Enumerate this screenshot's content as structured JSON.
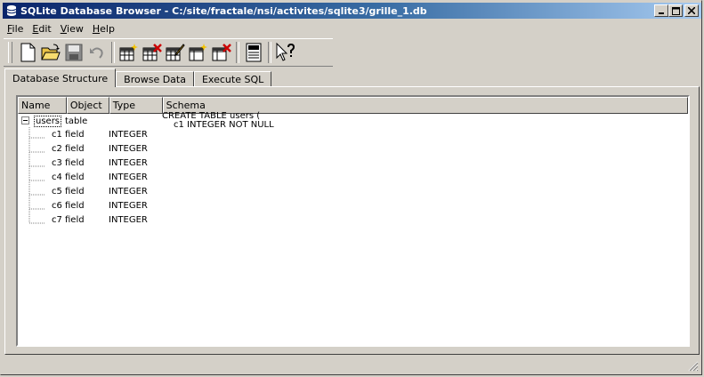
{
  "window": {
    "title": "SQLite Database Browser - C:/site/fractale/nsi/activites/sqlite3/grille_1.db",
    "buttons": {
      "minimize": "_",
      "maximize": "□",
      "close": "×"
    }
  },
  "menu": {
    "items": [
      "File",
      "Edit",
      "View",
      "Help"
    ]
  },
  "toolbar": {
    "buttons": [
      {
        "name": "new-database",
        "icon": "new-file-icon"
      },
      {
        "name": "open-database",
        "icon": "open-folder-icon"
      },
      {
        "name": "save-changes",
        "icon": "save-disk-icon"
      },
      {
        "name": "revert-changes",
        "icon": "undo-icon"
      },
      {
        "name": "create-table",
        "icon": "create-table-icon"
      },
      {
        "name": "delete-table",
        "icon": "delete-table-icon"
      },
      {
        "name": "modify-table",
        "icon": "modify-table-icon"
      },
      {
        "name": "create-index",
        "icon": "create-index-icon"
      },
      {
        "name": "delete-index",
        "icon": "delete-index-icon"
      },
      {
        "name": "sql-log",
        "icon": "log-icon"
      },
      {
        "name": "whats-this",
        "icon": "whats-this-icon"
      }
    ]
  },
  "tabs": [
    "Database Structure",
    "Browse Data",
    "Execute SQL"
  ],
  "tree": {
    "columns": [
      "Name",
      "Object",
      "Type",
      "Schema"
    ],
    "root": {
      "name": "users",
      "object": "table",
      "schema_line1": "CREATE TABLE users (",
      "schema_line2": "c1 INTEGER NOT NULL"
    },
    "fields": [
      {
        "name": "c1",
        "object": "field",
        "type": "INTEGER"
      },
      {
        "name": "c2",
        "object": "field",
        "type": "INTEGER"
      },
      {
        "name": "c3",
        "object": "field",
        "type": "INTEGER"
      },
      {
        "name": "c4",
        "object": "field",
        "type": "INTEGER"
      },
      {
        "name": "c5",
        "object": "field",
        "type": "INTEGER"
      },
      {
        "name": "c6",
        "object": "field",
        "type": "INTEGER"
      },
      {
        "name": "c7",
        "object": "field",
        "type": "INTEGER"
      }
    ]
  }
}
